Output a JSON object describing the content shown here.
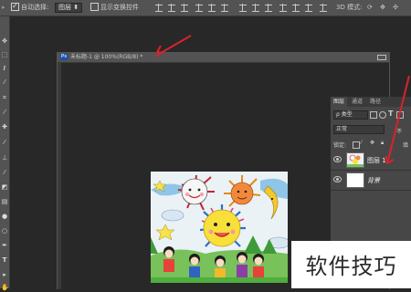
{
  "options_bar": {
    "auto_select_label": "自动选择:",
    "layer_select_value": "图层",
    "transform_controls_label": "显示变换控件",
    "mode_3d_label": "3D 模式:"
  },
  "document": {
    "title": "未标题-1 @ 100%(RGB/8) *",
    "app_badge": "Ps"
  },
  "layers_panel": {
    "tabs": [
      {
        "label": "图层",
        "active": true
      },
      {
        "label": "通道",
        "active": false
      },
      {
        "label": "路径",
        "active": false
      }
    ],
    "filter_kind": "ρ 类型",
    "blend_mode": "正常",
    "opacity_label_partial": "不",
    "lock_label": "锁定:",
    "fill_label_partial": "填",
    "layers": [
      {
        "name": "图层 1",
        "italic": false
      },
      {
        "name": "背景",
        "italic": true
      }
    ]
  },
  "watermark": {
    "text": "软件技巧"
  },
  "colors": {
    "arrow": "#d8232a",
    "panel_bg": "#474747",
    "chrome": "#535353",
    "canvas_bg": "#282828"
  },
  "icons": [
    "move-icon",
    "marquee-icon",
    "lasso-icon",
    "magic-wand-icon",
    "crop-icon",
    "eyedropper-icon",
    "brush-icon",
    "eraser-icon",
    "gradient-icon",
    "pen-icon",
    "type-icon",
    "hand-icon",
    "zoom-icon",
    "eye-icon",
    "lock-icon"
  ]
}
